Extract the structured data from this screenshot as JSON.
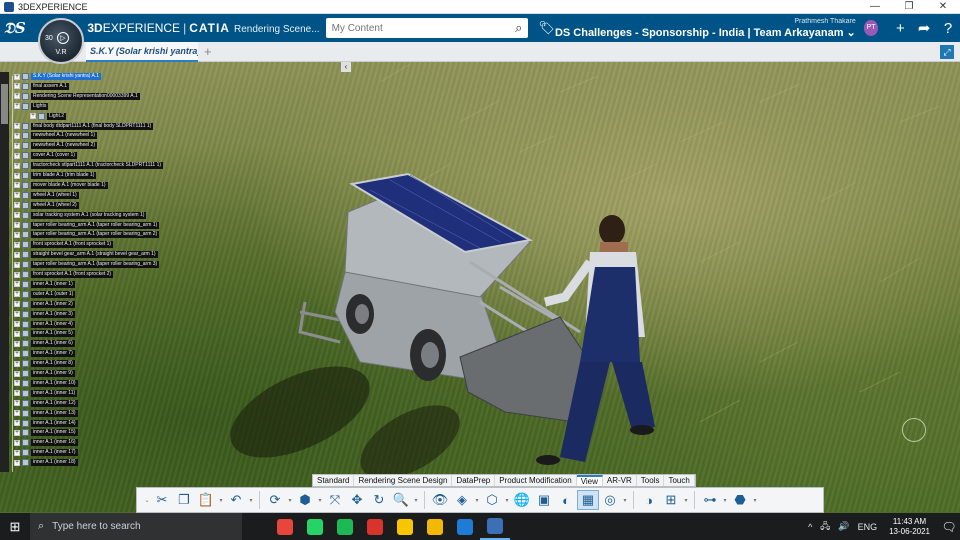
{
  "window": {
    "title": "3DEXPERIENCE",
    "minimize": "—",
    "restore": "❐",
    "close": "✕"
  },
  "header": {
    "brand_bold": "3D",
    "brand_rest": "EXPERIENCE",
    "separator": "|",
    "app_name": "CATIA",
    "context": "Rendering Scene...",
    "search_placeholder": "My Content",
    "user_name": "Prathmesh Thakare",
    "collab_space": "DS Challenges - Sponsorship - India | Team Arkayanam ⌄",
    "avatar_initials": "PT"
  },
  "compass": {
    "version": "V.R",
    "number": "30"
  },
  "tabs": {
    "document": "S.K.Y (Solar krishi yantra)",
    "add": "+"
  },
  "tree": {
    "collapse": "‹",
    "nodes": [
      {
        "label": "S.K.Y (Solar krishi yantra) A.1",
        "selected": true,
        "icon": false
      },
      {
        "label": "final assem A.1"
      },
      {
        "label": "Rendering Scene Representation00003399 A.1"
      },
      {
        "label": "Lights"
      },
      {
        "label": "Light.2",
        "indent": 2
      },
      {
        "label": "final body dtdpart1111 A.1 (final body SLDPRT1111 1)"
      },
      {
        "label": "newwheel A.1 (newwheel 1)"
      },
      {
        "label": "newwheel A.1 (newwheel 2)"
      },
      {
        "label": "cover A.1 (cover 1)"
      },
      {
        "label": "tractorcheck stlpart1111 A.1 (tractorcheck SLDPRT1111 1)"
      },
      {
        "label": "trim blade A.1 (trim blade 1)"
      },
      {
        "label": "mover blade A.1 (mover blade 1)"
      },
      {
        "label": "wheel A.1 (wheel 1)"
      },
      {
        "label": "wheel A.1 (wheel 2)"
      },
      {
        "label": "solar tracking system A.1 (solar tracking system 1)"
      },
      {
        "label": "taper roller bearing_arm A.1 (taper roller bearing_arm 1)"
      },
      {
        "label": "taper roller bearing_arm A.1 (taper roller bearing_arm 2)"
      },
      {
        "label": "front sprocket A.1 (front sprocket 1)"
      },
      {
        "label": "straight bevel gear_arm A.1 (straight bevel gear_arm 1)"
      },
      {
        "label": "taper roller bearing_arm A.1 (taper roller bearing_arm 3)"
      },
      {
        "label": "front sprocket A.1 (front sprocket 2)"
      },
      {
        "label": "inner A.1 (inner 1)"
      },
      {
        "label": "outer A.1 (outer 1)"
      },
      {
        "label": "inner A.1 (inner 2)"
      },
      {
        "label": "inner A.1 (inner 3)"
      },
      {
        "label": "inner A.1 (inner 4)"
      },
      {
        "label": "inner A.1 (inner 5)"
      },
      {
        "label": "inner A.1 (inner 6)"
      },
      {
        "label": "inner A.1 (inner 7)"
      },
      {
        "label": "inner A.1 (inner 8)"
      },
      {
        "label": "inner A.1 (inner 9)"
      },
      {
        "label": "inner A.1 (inner 10)"
      },
      {
        "label": "inner A.1 (inner 11)"
      },
      {
        "label": "inner A.1 (inner 12)"
      },
      {
        "label": "inner A.1 (inner 13)"
      },
      {
        "label": "inner A.1 (inner 14)"
      },
      {
        "label": "inner A.1 (inner 15)"
      },
      {
        "label": "inner A.1 (inner 16)"
      },
      {
        "label": "inner A.1 (inner 17)"
      },
      {
        "label": "inner A.1 (inner 18)"
      }
    ]
  },
  "sections": [
    "Standard",
    "Rendering Scene Design",
    "DataPrep",
    "Product Modification",
    "View",
    "AR-VR",
    "Tools",
    "Touch"
  ],
  "active_section": "View",
  "toolbar": [
    {
      "name": "cut-icon",
      "glyph": "✂"
    },
    {
      "name": "copy-icon",
      "glyph": "❐"
    },
    {
      "name": "paste-icon",
      "glyph": "📋",
      "caret": true
    },
    {
      "name": "undo-icon",
      "glyph": "↶",
      "caret": true
    },
    {
      "sep": true
    },
    {
      "name": "update-icon",
      "glyph": "⟳",
      "caret": true
    },
    {
      "name": "cube-view-icon",
      "glyph": "⬢",
      "caret": true
    },
    {
      "name": "fit-all-icon",
      "glyph": "⤧"
    },
    {
      "name": "pan-icon",
      "glyph": "✥"
    },
    {
      "name": "rotate-icon",
      "glyph": "↻"
    },
    {
      "name": "zoom-icon",
      "glyph": "🔍",
      "caret": true
    },
    {
      "sep": true
    },
    {
      "name": "view-selector-icon",
      "glyph": "👁"
    },
    {
      "name": "view-mode-icon",
      "glyph": "◈",
      "caret": true
    },
    {
      "name": "render-style-icon",
      "glyph": "⬡",
      "caret": true
    },
    {
      "name": "globe-icon",
      "glyph": "🌐"
    },
    {
      "name": "capture-icon",
      "glyph": "▣"
    },
    {
      "name": "visibility-icon",
      "glyph": "◐"
    },
    {
      "name": "ambiance-icon",
      "glyph": "▦",
      "active": true
    },
    {
      "name": "camera-icon",
      "glyph": "◎",
      "caret": true
    },
    {
      "sep": true
    },
    {
      "name": "environment-icon",
      "glyph": "◑"
    },
    {
      "name": "layout-icon",
      "glyph": "⊞",
      "caret": true
    },
    {
      "sep": true
    },
    {
      "name": "hierarchy-icon",
      "glyph": "⊶",
      "caret": true
    },
    {
      "name": "analysis-icon",
      "glyph": "⬣",
      "caret": true
    }
  ],
  "taskbar": {
    "start": "⊞",
    "search_placeholder": "Type here to search",
    "apps": [
      {
        "name": "chrome-icon",
        "color": "#e8453c"
      },
      {
        "name": "whatsapp-icon",
        "color": "#25d366"
      },
      {
        "name": "spotify-icon",
        "color": "#1db954"
      },
      {
        "name": "slides-app-icon",
        "color": "#d9342b"
      },
      {
        "name": "sticky-notes-icon",
        "color": "#f7c600"
      },
      {
        "name": "file-explorer-icon",
        "color": "#f2b900"
      },
      {
        "name": "photos-icon",
        "color": "#1e7bd6"
      },
      {
        "name": "3dexperience-app-icon",
        "color": "#3b6fb6",
        "running": true
      }
    ],
    "tray": [
      "^",
      "🖧",
      "🔊",
      "ENG"
    ],
    "time": "11:43 AM",
    "date": "13-06-2021",
    "notification": "🗨"
  }
}
